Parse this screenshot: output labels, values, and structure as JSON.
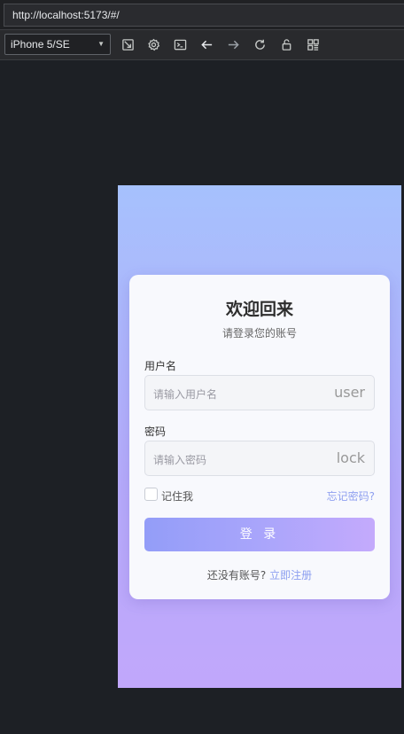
{
  "browser": {
    "url": "http://localhost:5173/#/"
  },
  "devtools": {
    "device": "iPhone 5/SE",
    "icons": [
      "rotate-icon",
      "settings-icon",
      "console-icon",
      "back-icon",
      "forward-icon",
      "reload-icon",
      "lock-icon",
      "grid-icon"
    ]
  },
  "login": {
    "title": "欢迎回来",
    "subtitle": "请登录您的账号",
    "username_label": "用户名",
    "username_placeholder": "请输入用户名",
    "username_suffix": "user",
    "password_label": "密码",
    "password_placeholder": "请输入密码",
    "password_suffix": "lock",
    "remember_label": "记住我",
    "forgot_link": "忘记密码?",
    "login_button": "登 录",
    "no_account_text": "还没有账号? ",
    "register_link": "立即注册"
  },
  "colors": {
    "accent": "#939df8",
    "link": "#8b9ef0",
    "gradient_top": "#a6c1fd",
    "gradient_bottom": "#c1a7fb"
  }
}
